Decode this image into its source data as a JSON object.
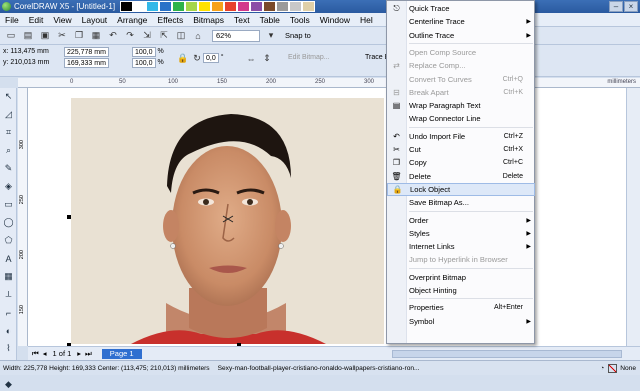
{
  "window": {
    "title": "CorelDRAW X5 - [Untitled-1]"
  },
  "palette": [
    "#000000",
    "#ffffff",
    "#33b8e8",
    "#2a72c8",
    "#2cb34a",
    "#a5d64a",
    "#ffe200",
    "#f6a21c",
    "#e8412c",
    "#d23a8c",
    "#8b4ea6",
    "#7a4a2a",
    "#9a9a9a",
    "#c8c8c8",
    "#e0d0a8"
  ],
  "menubar": [
    "File",
    "Edit",
    "View",
    "Layout",
    "Arrange",
    "Effects",
    "Bitmaps",
    "Text",
    "Table",
    "Tools",
    "Window",
    "Hel"
  ],
  "toolbar1": {
    "zoom": "62%",
    "snap": "Snap to"
  },
  "propertybar": {
    "x": "x: 113,475 mm",
    "y": "y: 210,013 mm",
    "w": "225,778 mm",
    "h": "169,333 mm",
    "sx": "100,0",
    "sy": "100,0",
    "pct": "%",
    "rot": "0,0",
    "deg": "°",
    "edit_bitmap": "Edit Bitmap...",
    "trace": "Trace B"
  },
  "ruler": {
    "units": "millimeters",
    "ticks": [
      "0",
      "50",
      "100",
      "150",
      "200",
      "250",
      "300",
      "350"
    ]
  },
  "vruler_ticks": [
    "300",
    "250",
    "200",
    "150"
  ],
  "context_menu": {
    "items": [
      {
        "label": "Quick Trace",
        "icon": "trace-icon",
        "enabled": true
      },
      {
        "label": "Centerline Trace",
        "submenu": true,
        "enabled": true
      },
      {
        "label": "Outline Trace",
        "submenu": true,
        "enabled": true
      },
      {
        "sep": true
      },
      {
        "label": "Open Comp Source",
        "enabled": false
      },
      {
        "label": "Replace Comp...",
        "icon": "replace-icon",
        "enabled": false
      },
      {
        "label": "Convert To Curves",
        "shortcut": "Ctrl+Q",
        "enabled": false
      },
      {
        "label": "Break Apart",
        "shortcut": "Ctrl+K",
        "icon": "break-apart-icon",
        "enabled": false
      },
      {
        "label": "Wrap Paragraph Text",
        "icon": "wrap-text-icon",
        "enabled": true
      },
      {
        "label": "Wrap Connector Line",
        "enabled": true
      },
      {
        "sep": true
      },
      {
        "label": "Undo Import File",
        "shortcut": "Ctrl+Z",
        "icon": "undo-icon",
        "enabled": true
      },
      {
        "label": "Cut",
        "shortcut": "Ctrl+X",
        "icon": "cut-icon",
        "enabled": true
      },
      {
        "label": "Copy",
        "shortcut": "Ctrl+C",
        "icon": "copy-icon",
        "enabled": true
      },
      {
        "label": "Delete",
        "shortcut": "Delete",
        "icon": "delete-icon",
        "enabled": true
      },
      {
        "label": "Lock Object",
        "icon": "lock-icon",
        "enabled": true,
        "highlighted": true
      },
      {
        "label": "Save Bitmap As...",
        "enabled": true
      },
      {
        "sep": true
      },
      {
        "label": "Order",
        "submenu": true,
        "enabled": true
      },
      {
        "label": "Styles",
        "submenu": true,
        "enabled": true
      },
      {
        "label": "Internet Links",
        "submenu": true,
        "enabled": true
      },
      {
        "label": "Jump to Hyperlink in Browser",
        "enabled": false
      },
      {
        "sep": true
      },
      {
        "label": "Overprint Bitmap",
        "enabled": true
      },
      {
        "label": "Object Hinting",
        "enabled": true
      },
      {
        "sep": true
      },
      {
        "label": "Properties",
        "shortcut": "Alt+Enter",
        "enabled": true
      },
      {
        "label": "Symbol",
        "submenu": true,
        "enabled": true
      }
    ]
  },
  "pagebar": {
    "counter": "1 of 1",
    "tab": "Page 1"
  },
  "status": {
    "info": "Width: 225,778  Height: 169,333  Center: (113,475; 210,013)  millimeters",
    "file": "Sexy-man-football-player-cristiano-ronaldo-wallpapers-cristiano-ron...",
    "fill": "None"
  }
}
